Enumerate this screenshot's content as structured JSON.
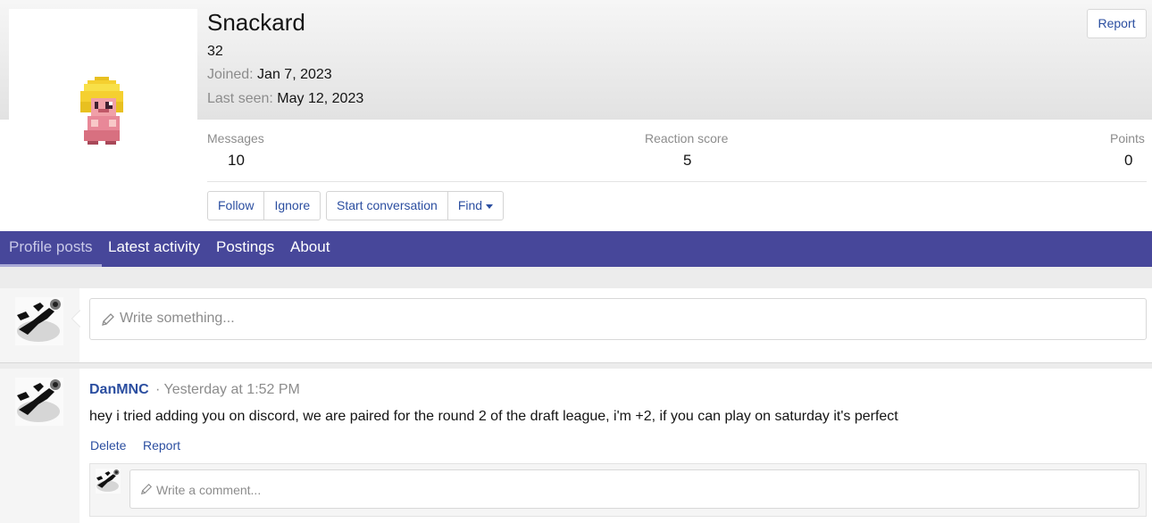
{
  "profile": {
    "username": "Snackard",
    "user_title": "32",
    "joined_label": "Joined:",
    "joined_value": "Jan 7, 2023",
    "last_seen_label": "Last seen:",
    "last_seen_value": "May 12, 2023",
    "report_label": "Report",
    "avatar_icon": "pixel-character-avatar-icon"
  },
  "stats": [
    {
      "label": "Messages",
      "value": "10"
    },
    {
      "label": "Reaction score",
      "value": "5"
    },
    {
      "label": "Points",
      "value": "0"
    }
  ],
  "actions": {
    "follow": "Follow",
    "ignore": "Ignore",
    "start_conversation": "Start conversation",
    "find": "Find"
  },
  "tabs": [
    {
      "label": "Profile posts",
      "active": true
    },
    {
      "label": "Latest activity",
      "active": false
    },
    {
      "label": "Postings",
      "active": false
    },
    {
      "label": "About",
      "active": false
    }
  ],
  "composer": {
    "placeholder": "Write something..."
  },
  "post": {
    "author": "DanMNC",
    "time": "· Yesterday at 1:52 PM",
    "body": "hey i tried adding you on discord, we are paired for the round 2 of the draft league, i'm +2, if you can play on saturday it's perfect",
    "delete_label": "Delete",
    "report_label": "Report",
    "comment_placeholder": "Write a comment..."
  },
  "colors": {
    "tab_bar": "#47479a",
    "link": "#2b4ea0"
  }
}
